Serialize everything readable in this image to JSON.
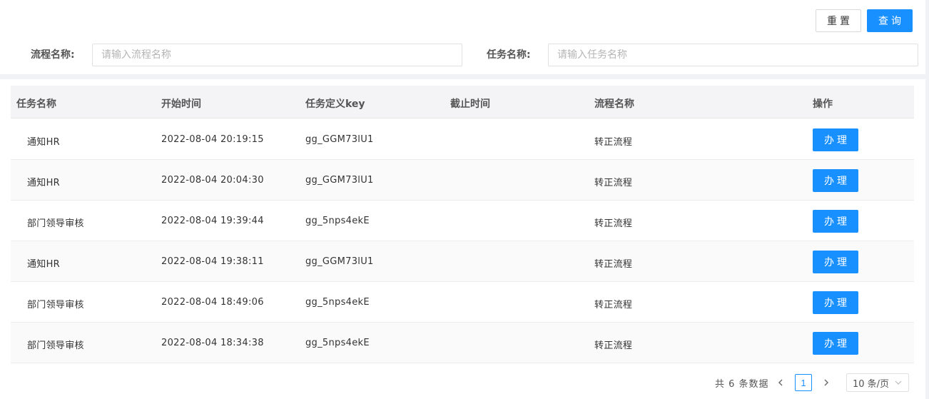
{
  "toolbar": {
    "reset_label": "重置",
    "query_label": "查询"
  },
  "search": {
    "process_label": "流程名称:",
    "process_placeholder": "请输入流程名称",
    "process_value": "",
    "task_label": "任务名称:",
    "task_placeholder": "请输入任务名称",
    "task_value": ""
  },
  "table": {
    "headers": [
      "任务名称",
      "开始时间",
      "任务定义key",
      "截止时间",
      "流程名称",
      "操作"
    ],
    "action_label": "办理",
    "rows": [
      {
        "task": "通知HR",
        "start": "2022-08-04 20:19:15",
        "key": "gg_GGM73lU1",
        "deadline": "",
        "process": "转正流程"
      },
      {
        "task": "通知HR",
        "start": "2022-08-04 20:04:30",
        "key": "gg_GGM73lU1",
        "deadline": "",
        "process": "转正流程"
      },
      {
        "task": "部门领导审核",
        "start": "2022-08-04 19:39:44",
        "key": "gg_5nps4ekE",
        "deadline": "",
        "process": "转正流程"
      },
      {
        "task": "通知HR",
        "start": "2022-08-04 19:38:11",
        "key": "gg_GGM73lU1",
        "deadline": "",
        "process": "转正流程"
      },
      {
        "task": "部门领导审核",
        "start": "2022-08-04 18:49:06",
        "key": "gg_5nps4ekE",
        "deadline": "",
        "process": "转正流程"
      },
      {
        "task": "部门领导审核",
        "start": "2022-08-04 18:34:38",
        "key": "gg_5nps4ekE",
        "deadline": "",
        "process": "转正流程"
      }
    ]
  },
  "pagination": {
    "total_text": "共 6 条数据",
    "current_page": "1",
    "page_size": "10 条/页",
    "prev_icon": "chevron-left-icon",
    "next_icon": "chevron-right-icon"
  },
  "colors": {
    "primary": "#1890ff",
    "background": "#f0f2f5",
    "header_bg": "#f4f4f6"
  }
}
